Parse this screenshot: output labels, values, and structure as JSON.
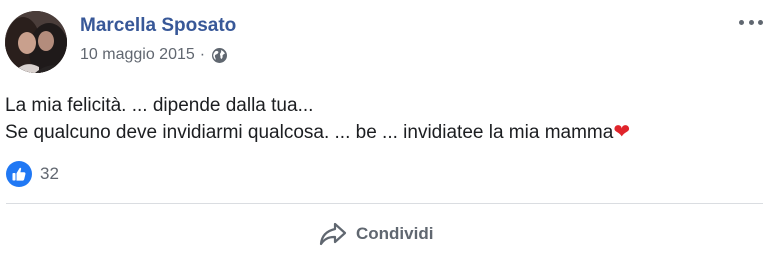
{
  "post": {
    "author": "Marcella Sposato",
    "date": "10 maggio 2015",
    "separator": "·",
    "privacy_icon": "globe-icon",
    "more_icon": "more-options-icon",
    "lines": [
      "La mia felicità. ... dipende dalla tua...",
      "Se qualcuno deve invidiarmi qualcosa. ... be ... invidiatee la mia mamma"
    ],
    "emoji": "❤"
  },
  "reactions": {
    "icon": "like-icon",
    "count": "32"
  },
  "actions": {
    "share_label": "Condividi",
    "share_icon": "share-arrow-icon"
  },
  "colors": {
    "author": "#385898",
    "meta": "#616770",
    "like_badge": "#2078f4",
    "heart": "#e0242b",
    "divider": "#dadde1"
  }
}
